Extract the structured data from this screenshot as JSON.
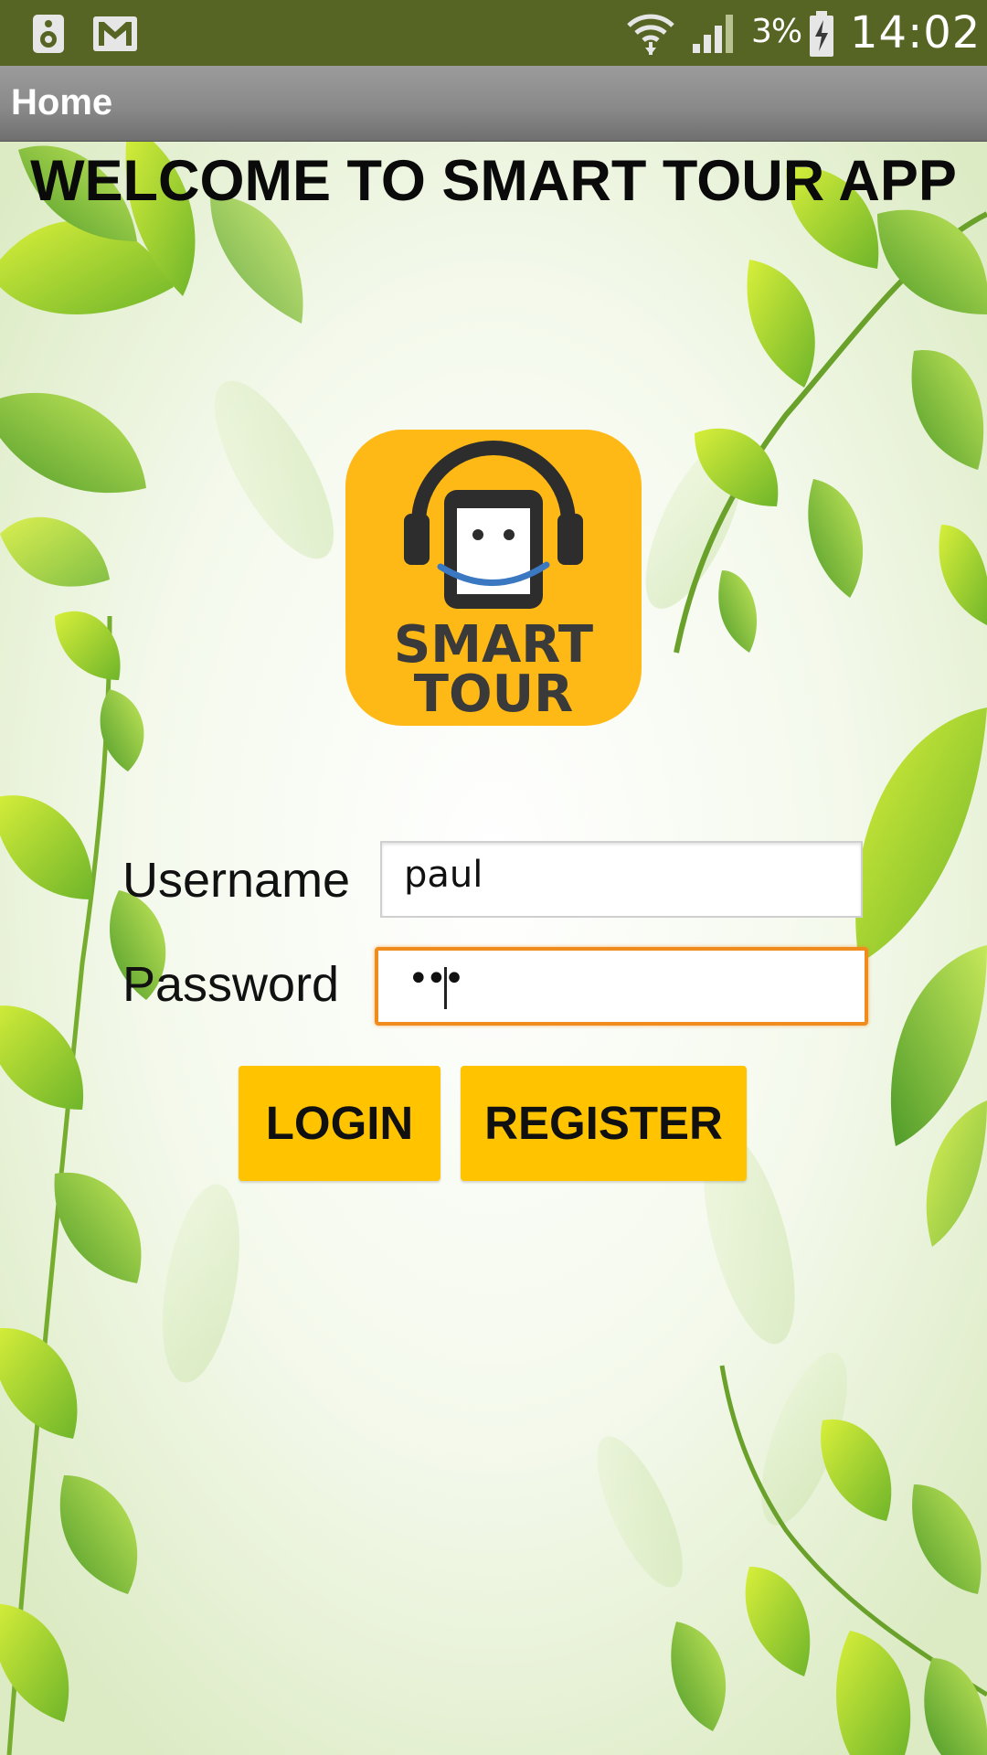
{
  "status_bar": {
    "battery_percent": "3%",
    "time": "14:02",
    "icons": [
      "speaker-notification-icon",
      "gmail-icon",
      "wifi-icon",
      "signal-icon",
      "battery-charging-icon"
    ]
  },
  "action_bar": {
    "title": "Home"
  },
  "main": {
    "welcome_title": "WELCOME TO SMART TOUR APP",
    "logo": {
      "line1": "SMART",
      "line2": "TOUR",
      "icon": "headphones-phone-smile-logo"
    },
    "form": {
      "username_label": "Username",
      "username_value": "paul",
      "password_label": "Password",
      "password_value": "•••",
      "password_focused": true
    },
    "buttons": {
      "login_label": "LOGIN",
      "register_label": "REGISTER"
    }
  },
  "colors": {
    "status_bar": "#566524",
    "action_bar": "#8a8a8a",
    "button": "#ffc300",
    "logo_bg": "#ffb916",
    "focus_border": "#f08b1e"
  }
}
